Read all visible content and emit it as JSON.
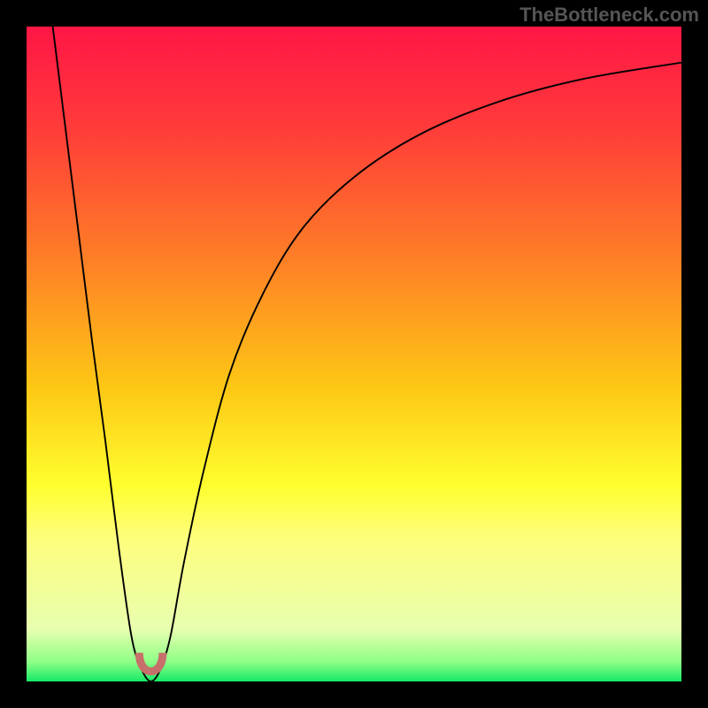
{
  "annotation_text": "TheBottleneck.com",
  "gradient": {
    "stops": [
      {
        "offset": "0%",
        "color": "#ff1646"
      },
      {
        "offset": "15%",
        "color": "#ff3a3a"
      },
      {
        "offset": "35%",
        "color": "#fe7d27"
      },
      {
        "offset": "55%",
        "color": "#fdc715"
      },
      {
        "offset": "70%",
        "color": "#fffe2e"
      },
      {
        "offset": "78%",
        "color": "#fefe7c"
      },
      {
        "offset": "92%",
        "color": "#e8ffb0"
      },
      {
        "offset": "97%",
        "color": "#8eff86"
      },
      {
        "offset": "100%",
        "color": "#17e967"
      }
    ]
  },
  "chart_data": {
    "type": "line",
    "title": "",
    "xlabel": "",
    "ylabel": "",
    "xlim": [
      0,
      100
    ],
    "ylim": [
      0,
      100
    ],
    "series": [
      {
        "name": "curve",
        "x": [
          4,
          6,
          8,
          10,
          12,
          14,
          16,
          17.5,
          19,
          20.5,
          22,
          24,
          27,
          31,
          36,
          42,
          50,
          60,
          72,
          85,
          100
        ],
        "y": [
          100,
          84,
          68,
          52,
          37,
          21,
          7,
          2,
          0,
          2,
          7,
          18,
          32,
          47,
          59,
          69,
          77,
          83.5,
          88.5,
          92,
          94.5
        ]
      }
    ],
    "notch": {
      "x_center": 19,
      "y_center": 1.5,
      "radius": 1.8,
      "stroke_color": "#c76f6a",
      "stroke_width": 1.2
    }
  }
}
